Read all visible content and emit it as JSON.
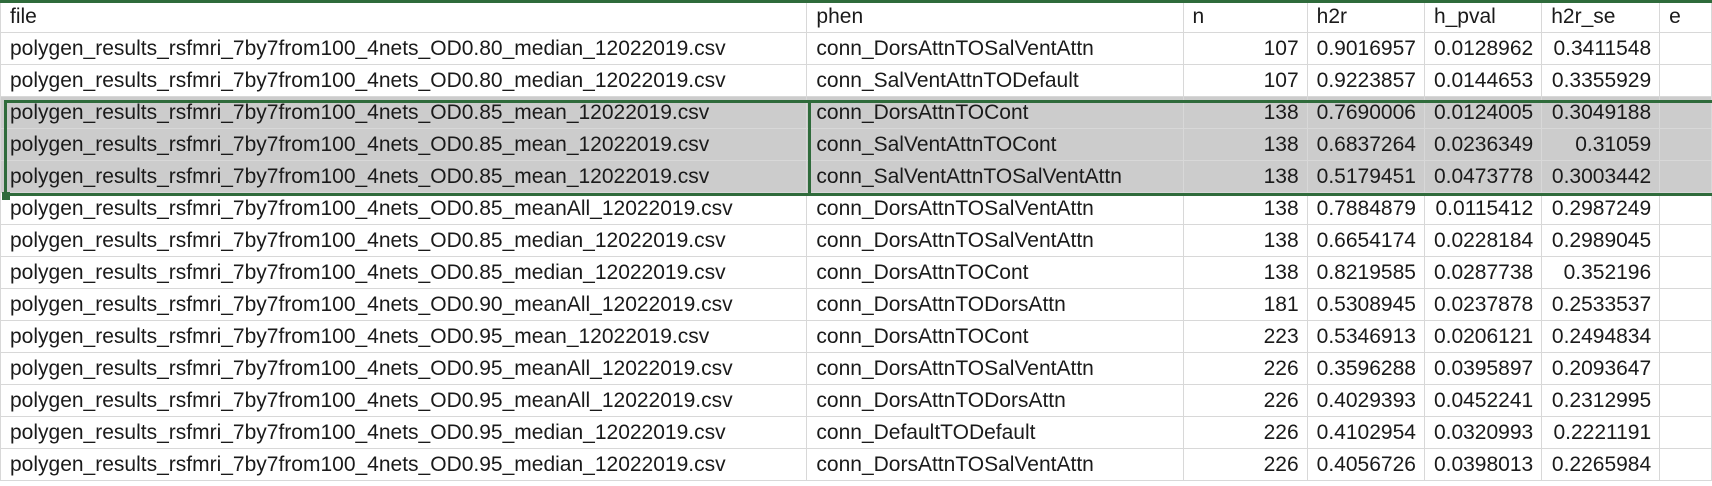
{
  "headers": {
    "file": "file",
    "phen": "phen",
    "n": "n",
    "h2r": "h2r",
    "h_pval": "h_pval",
    "h2r_se": "h2r_se",
    "extra": "e"
  },
  "rows": [
    {
      "file": "polygen_results_rsfmri_7by7from100_4nets_OD0.80_median_12022019.csv",
      "phen": "conn_DorsAttnTOSalVentAttn",
      "n": "107",
      "h2r": "0.9016957",
      "h_pval": "0.0128962",
      "h2r_se": "0.3411548",
      "selected": false
    },
    {
      "file": "polygen_results_rsfmri_7by7from100_4nets_OD0.80_median_12022019.csv",
      "phen": "conn_SalVentAttnTODefault",
      "n": "107",
      "h2r": "0.9223857",
      "h_pval": "0.0144653",
      "h2r_se": "0.3355929",
      "selected": false
    },
    {
      "file": "polygen_results_rsfmri_7by7from100_4nets_OD0.85_mean_12022019.csv",
      "phen": "conn_DorsAttnTOCont",
      "n": "138",
      "h2r": "0.7690006",
      "h_pval": "0.0124005",
      "h2r_se": "0.3049188",
      "selected": true
    },
    {
      "file": "polygen_results_rsfmri_7by7from100_4nets_OD0.85_mean_12022019.csv",
      "phen": "conn_SalVentAttnTOCont",
      "n": "138",
      "h2r": "0.6837264",
      "h_pval": "0.0236349",
      "h2r_se": "0.31059",
      "selected": true
    },
    {
      "file": "polygen_results_rsfmri_7by7from100_4nets_OD0.85_mean_12022019.csv",
      "phen": "conn_SalVentAttnTOSalVentAttn",
      "n": "138",
      "h2r": "0.5179451",
      "h_pval": "0.0473778",
      "h2r_se": "0.3003442",
      "selected": true
    },
    {
      "file": "polygen_results_rsfmri_7by7from100_4nets_OD0.85_meanAll_12022019.csv",
      "phen": "conn_DorsAttnTOSalVentAttn",
      "n": "138",
      "h2r": "0.7884879",
      "h_pval": "0.0115412",
      "h2r_se": "0.2987249",
      "selected": false
    },
    {
      "file": "polygen_results_rsfmri_7by7from100_4nets_OD0.85_median_12022019.csv",
      "phen": "conn_DorsAttnTOSalVentAttn",
      "n": "138",
      "h2r": "0.6654174",
      "h_pval": "0.0228184",
      "h2r_se": "0.2989045",
      "selected": false
    },
    {
      "file": "polygen_results_rsfmri_7by7from100_4nets_OD0.85_median_12022019.csv",
      "phen": "conn_DorsAttnTOCont",
      "n": "138",
      "h2r": "0.8219585",
      "h_pval": "0.0287738",
      "h2r_se": "0.352196",
      "selected": false
    },
    {
      "file": "polygen_results_rsfmri_7by7from100_4nets_OD0.90_meanAll_12022019.csv",
      "phen": "conn_DorsAttnTODorsAttn",
      "n": "181",
      "h2r": "0.5308945",
      "h_pval": "0.0237878",
      "h2r_se": "0.2533537",
      "selected": false
    },
    {
      "file": "polygen_results_rsfmri_7by7from100_4nets_OD0.95_mean_12022019.csv",
      "phen": "conn_DorsAttnTOCont",
      "n": "223",
      "h2r": "0.5346913",
      "h_pval": "0.0206121",
      "h2r_se": "0.2494834",
      "selected": false
    },
    {
      "file": "polygen_results_rsfmri_7by7from100_4nets_OD0.95_meanAll_12022019.csv",
      "phen": "conn_DorsAttnTOSalVentAttn",
      "n": "226",
      "h2r": "0.3596288",
      "h_pval": "0.0395897",
      "h2r_se": "0.2093647",
      "selected": false
    },
    {
      "file": "polygen_results_rsfmri_7by7from100_4nets_OD0.95_meanAll_12022019.csv",
      "phen": "conn_DorsAttnTODorsAttn",
      "n": "226",
      "h2r": "0.4029393",
      "h_pval": "0.0452241",
      "h2r_se": "0.2312995",
      "selected": false
    },
    {
      "file": "polygen_results_rsfmri_7by7from100_4nets_OD0.95_median_12022019.csv",
      "phen": "conn_DefaultTODefault",
      "n": "226",
      "h2r": "0.4102954",
      "h_pval": "0.0320993",
      "h2r_se": "0.2221191",
      "selected": false
    },
    {
      "file": "polygen_results_rsfmri_7by7from100_4nets_OD0.95_median_12022019.csv",
      "phen": "conn_DorsAttnTOSalVentAttn",
      "n": "226",
      "h2r": "0.4056726",
      "h_pval": "0.0398013",
      "h2r_se": "0.2265984",
      "selected": false
    }
  ],
  "colors": {
    "selection_border": "#2f6b3b",
    "selection_fill": "#cccccc",
    "gridline": "#d8d8d8"
  }
}
